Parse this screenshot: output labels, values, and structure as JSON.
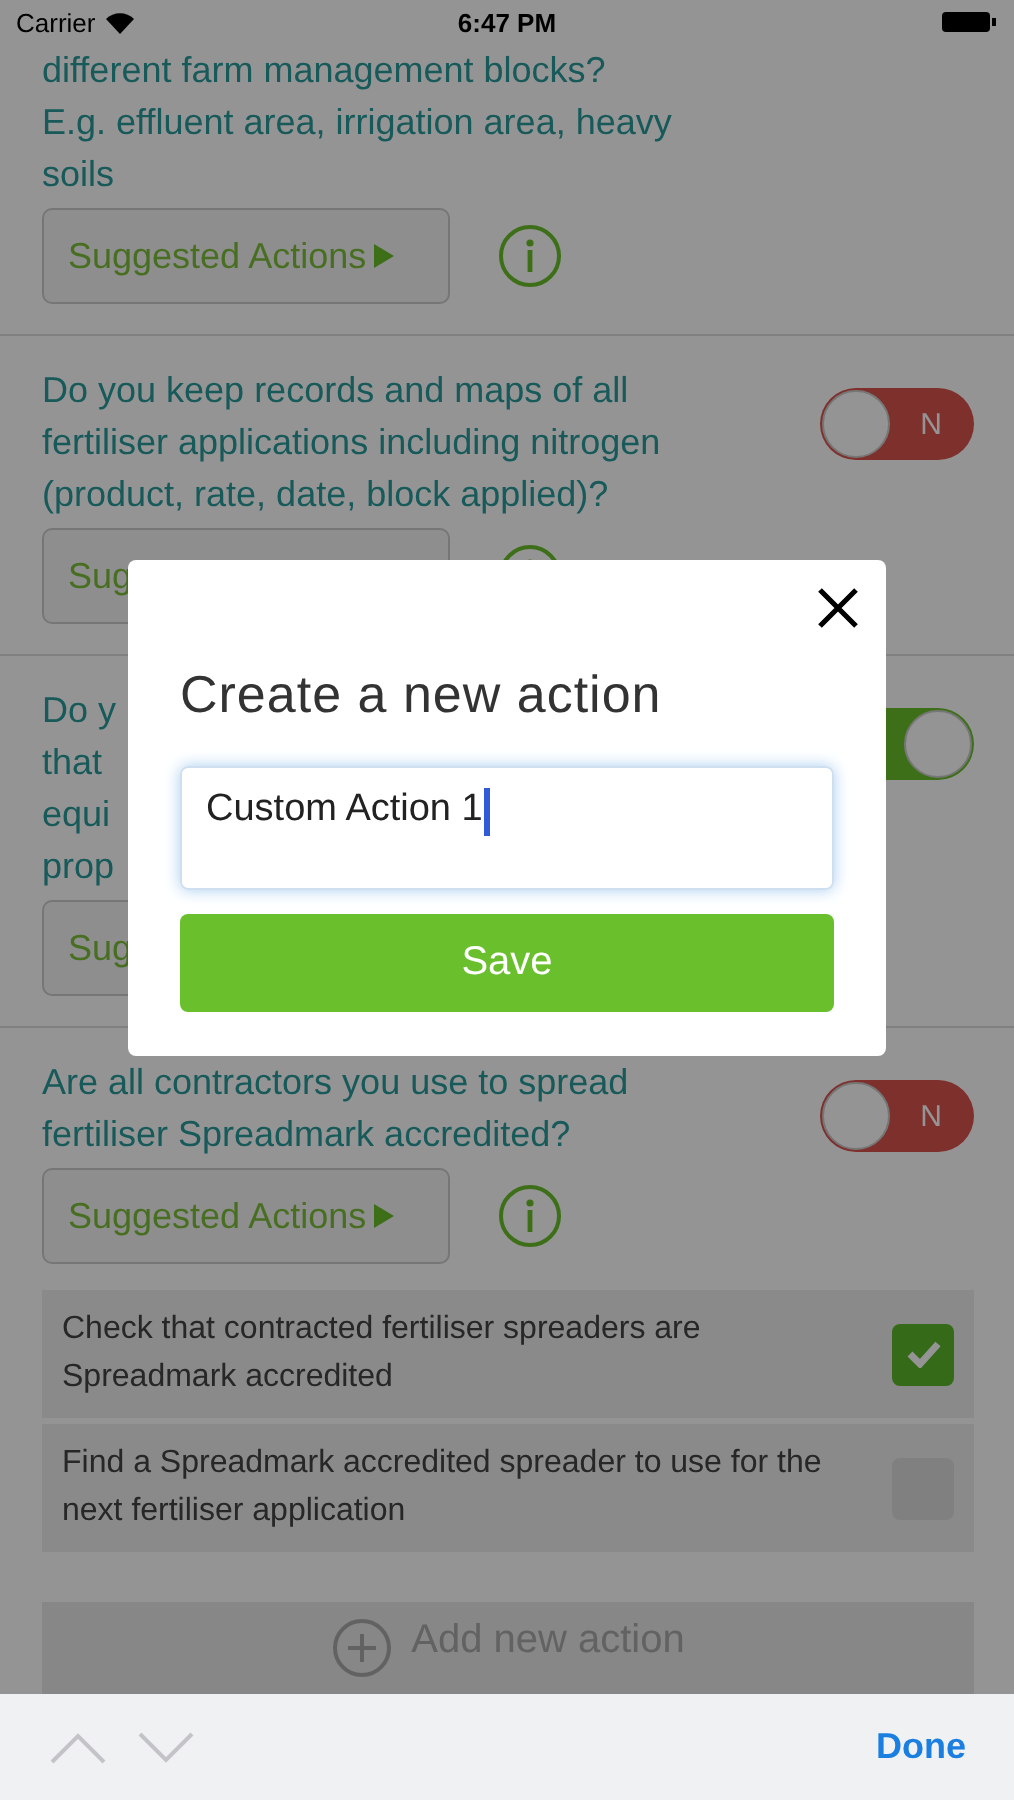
{
  "status_bar": {
    "carrier": "Carrier",
    "time": "6:47 PM"
  },
  "questions": [
    {
      "lines": [
        "different farm management blocks?",
        "E.g. effluent area, irrigation area, heavy",
        "soils"
      ],
      "button": "Suggested Actions",
      "caret": true,
      "info_icon": true
    },
    {
      "lines": [
        "Do you keep records and maps of all",
        "fertiliser applications including nitrogen",
        "(product, rate, date, block applied)?"
      ],
      "toggle": {
        "on": false,
        "label": "N"
      },
      "button": "Sug",
      "caret": false,
      "info_icon": true
    },
    {
      "lines": [
        "Do y",
        "that",
        "equi",
        "prop"
      ],
      "toggle": {
        "on": true
      },
      "button": "Sug",
      "caret": false,
      "info_icon": false
    },
    {
      "lines": [
        "Are all contractors you use to spread",
        "fertiliser Spreadmark accredited?"
      ],
      "toggle": {
        "on": false,
        "label": "N"
      },
      "button": "Suggested Actions",
      "caret": true,
      "info_icon": true,
      "actions": [
        {
          "text": "Check that contracted fertiliser spreaders are Spreadmark accredited",
          "checked": true
        },
        {
          "text": "Find a Spreadmark accredited spreader to use for the next fertiliser application",
          "checked": false
        }
      ]
    }
  ],
  "add_action": "Add new action",
  "dialog": {
    "title": "Create a new action",
    "value": "Custom Action 1",
    "save": "Save"
  },
  "keyboard_bar": {
    "done": "Done"
  }
}
